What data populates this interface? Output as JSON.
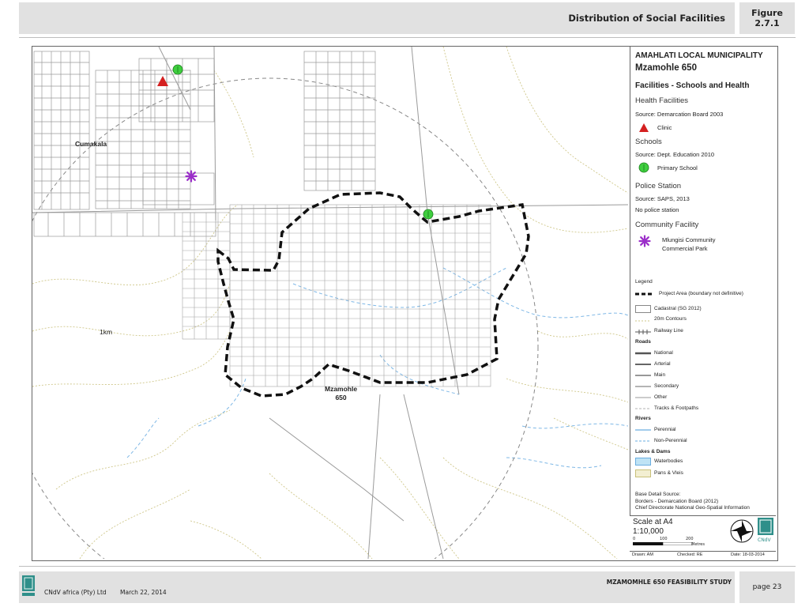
{
  "header": {
    "title": "Distribution of Social Facilities",
    "figure_label": "Figure",
    "figure_number": "2.7.1"
  },
  "map": {
    "place_labels": {
      "cumakala": "Cumakala",
      "mzamohle_line1": "Mzamohle",
      "mzamohle_line2": "650",
      "radius": "1km"
    }
  },
  "legend": {
    "municipality": "AMAHLATI LOCAL MUNICIPALITY",
    "project": "Mzamohle 650",
    "subtitle": "Facilities - Schools and Health",
    "health_heading": "Health Facilities",
    "health_source": "Source: Demarcation Board 2003",
    "clinic": "Clinic",
    "schools_heading": "Schools",
    "schools_source": "Source: Dept. Education 2010",
    "primary_school": "Primary School",
    "police_heading": "Police Station",
    "police_source": "Source: SAPS, 2013",
    "police_note": "No police station",
    "community_heading": "Community Facility",
    "community_line1": "Mlungisi Community",
    "community_line2": "Commercial Park",
    "legend_heading": "Legend",
    "project_area": "Project Area (boundary not definitive)",
    "cadastral": "Cadastral (SG 2012)",
    "contours": "20m Contours",
    "railway": "Railway Line",
    "roads_heading": "Roads",
    "roads": [
      "National",
      "Arterial",
      "Main",
      "Secondary",
      "Other",
      "Tracks & Footpaths"
    ],
    "rivers_heading": "Rivers",
    "perennial": "Perennial",
    "non_perennial": "Non-Perennial",
    "lakes_heading": "Lakes & Dams",
    "waterbodies": "Waterbodies",
    "pans": "Pans & Vleis",
    "base_source_heading": "Base Detail Source:",
    "base_source_1": "Borders - Demarcation Board (2012)",
    "base_source_2": "Chief Directorate National Geo-Spatial Information"
  },
  "scale": {
    "line1": "Scale at A4",
    "line2": "1:10,000",
    "ticks": [
      "0",
      "100",
      "200"
    ],
    "unit": "Metres",
    "drawn": "Drawn: AM",
    "checked": "Checked: RE",
    "date": "Date: 18-03-2014",
    "logo_text": "CNdV"
  },
  "footer": {
    "report_title": "MZAMOMHLE 650 FEASIBILITY STUDY",
    "company": "CNdV africa (Pty) Ltd",
    "date": "March 22, 2014",
    "page": "page 23"
  },
  "colors": {
    "clinic": "#d42020",
    "school": "#3fcf3f",
    "community": "#9b2fc9",
    "contour": "#c8c07a",
    "river": "#6aaee0",
    "cadastral": "#9a9a9a",
    "boundary": "#111111",
    "waterbody": "#bfe3f5"
  }
}
